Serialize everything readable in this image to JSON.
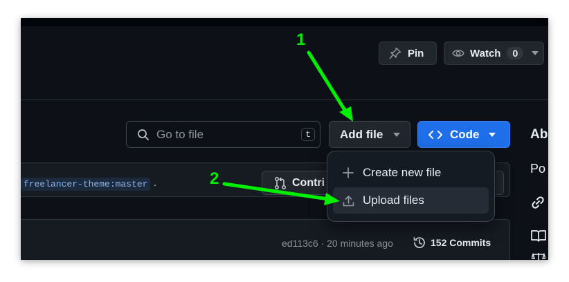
{
  "header": {
    "pin_label": "Pin",
    "watch_label": "Watch",
    "watch_count": "0"
  },
  "search": {
    "placeholder": "Go to file",
    "shortcut": "t"
  },
  "toolbar": {
    "add_file_label": "Add file",
    "code_label": "Code"
  },
  "branch_chip": "freelancer-theme:master",
  "branch_suffix": ".",
  "contribute_label": "Contri",
  "menu": {
    "items": [
      {
        "label": "Create new file"
      },
      {
        "label": "Upload files"
      }
    ]
  },
  "commit": {
    "meta": "ed113c6 · 20 minutes ago",
    "count_label": "152 Commits"
  },
  "about": {
    "title": "Ab",
    "text": "Po"
  },
  "annotations": {
    "step1": "1",
    "step2": "2"
  },
  "colors": {
    "green_annotation": "#00ee00",
    "code_button": "#1f6feb",
    "bg": "#0d1117"
  }
}
